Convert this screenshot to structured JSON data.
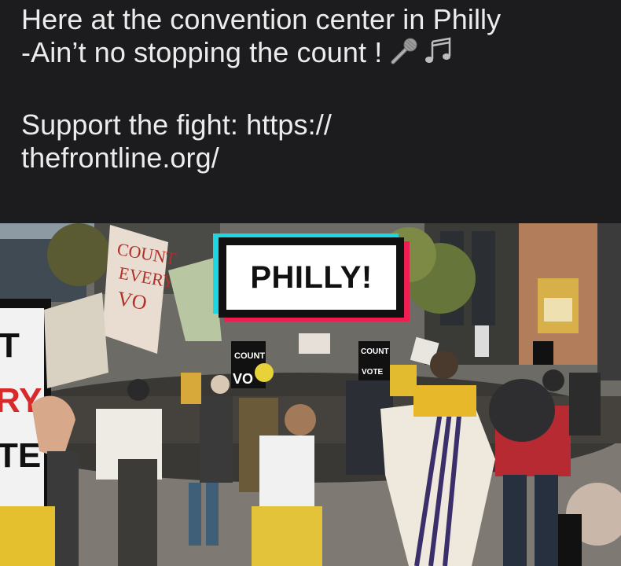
{
  "caption": {
    "line1": "Here at the convention center in Philly",
    "line2": "-Ain’t no stopping the count !",
    "line3": "Support the fight: https://",
    "line4": "thefrontline.org/",
    "emoji": [
      "microphone-icon",
      "musical-notes-icon"
    ]
  },
  "video": {
    "sticker_text": "PHILLY!",
    "signs": {
      "count_every_vote": "COUNT EVERY VOTE",
      "count": "COUNT",
      "vote": "VOTE",
      "left_sign_letters": "T RY TE"
    }
  },
  "colors": {
    "caption_bg": "#1c1c1e",
    "caption_text": "#ececec",
    "sticker_cyan": "#1fd6e0",
    "sticker_red": "#ee1d52"
  }
}
